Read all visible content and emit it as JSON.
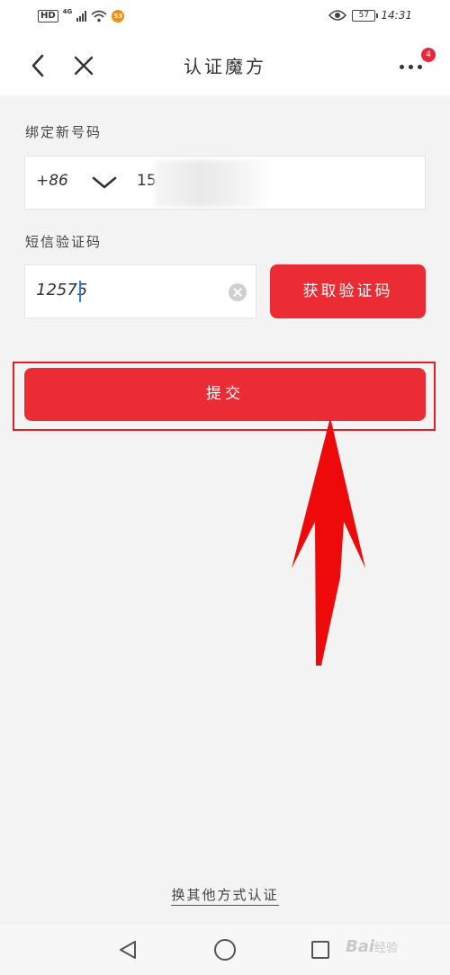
{
  "status_bar": {
    "hd": "HD",
    "network": "4G",
    "badge": "53",
    "battery": "57",
    "time": "14:31"
  },
  "nav": {
    "title": "认证魔方",
    "more_badge": "4"
  },
  "form": {
    "phone_label": "绑定新号码",
    "country_code": "+86",
    "phone_value": "15",
    "sms_label": "短信验证码",
    "sms_value": "12575",
    "get_code_button": "获取验证码",
    "submit_button": "提交"
  },
  "footer": {
    "switch_link": "换其他方式认证",
    "watermark_brand": "Bai",
    "watermark_suffix": "经验"
  },
  "colors": {
    "accent": "#ec2c35",
    "annotation": "#e02026",
    "background": "#f3f3f3"
  }
}
